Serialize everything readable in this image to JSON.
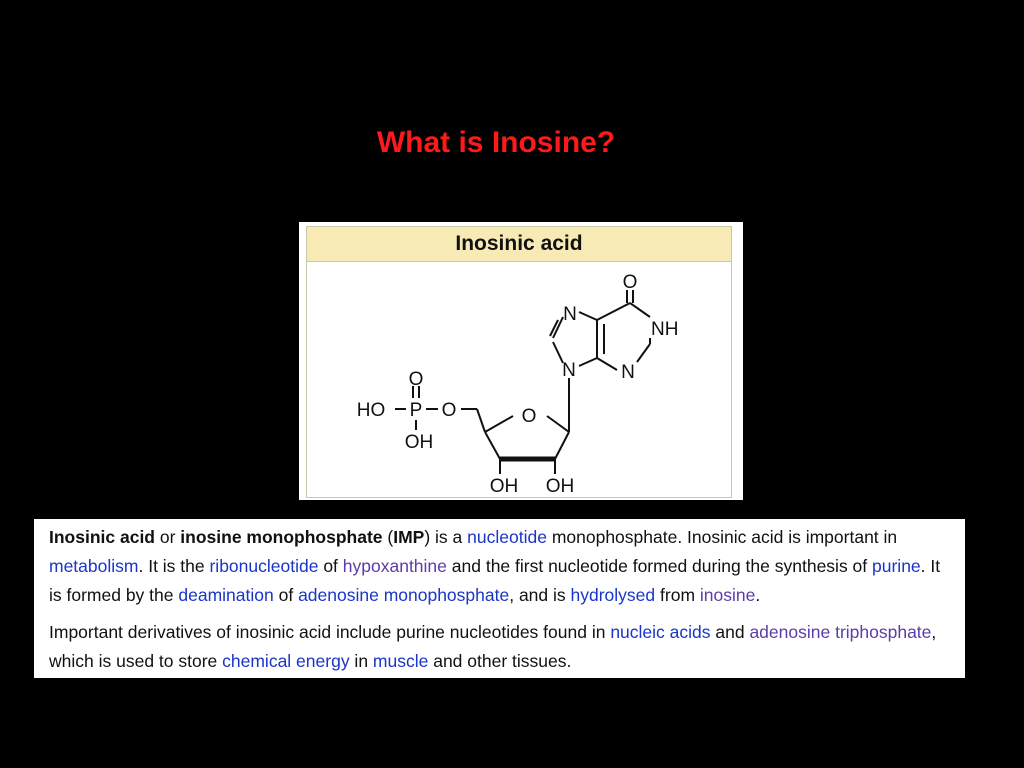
{
  "slide": {
    "title": "What is Inosine?"
  },
  "infobox": {
    "header": "Inosinic acid",
    "atoms": {
      "o_carbonyl": "O",
      "nh": "NH",
      "n7": "N",
      "n9": "N",
      "n3": "N",
      "ring_o": "O",
      "p_o": "O",
      "ho": "HO",
      "p": "P",
      "o_link": "O",
      "p_oh": "OH",
      "oh_3": "OH",
      "oh_2": "OH"
    }
  },
  "description": {
    "p1": {
      "t1": "Inosinic acid",
      "t2": " or ",
      "t3": "inosine monophosphate",
      "t4": " (",
      "t5": "IMP",
      "t6": ") is a ",
      "l1": "nucleotide",
      "t7": " monophosphate. Inosinic acid is important in ",
      "l2": "metabolism",
      "t8": ". It is the ",
      "l3": "ribonucleotide",
      "t9": " of ",
      "l4": "hypoxanthine",
      "t10": " and the first nucleotide formed during the synthesis of ",
      "l5": "purine",
      "t11": ". It is formed by the ",
      "l6": "deamination",
      "t12": " of ",
      "l7": "adenosine monophosphate",
      "t13": ", and is ",
      "l8": "hydrolysed",
      "t14": " from ",
      "l9": "inosine",
      "t15": "."
    },
    "p2": {
      "t1": "Important derivatives of inosinic acid include purine nucleotides found in ",
      "l1": "nucleic acids",
      "t2": " and ",
      "l2": "adenosine triphosphate",
      "t3": ", which is used to store ",
      "l3": "chemical energy",
      "t4": " in ",
      "l4": "muscle",
      "t5": " and other tissues."
    }
  }
}
